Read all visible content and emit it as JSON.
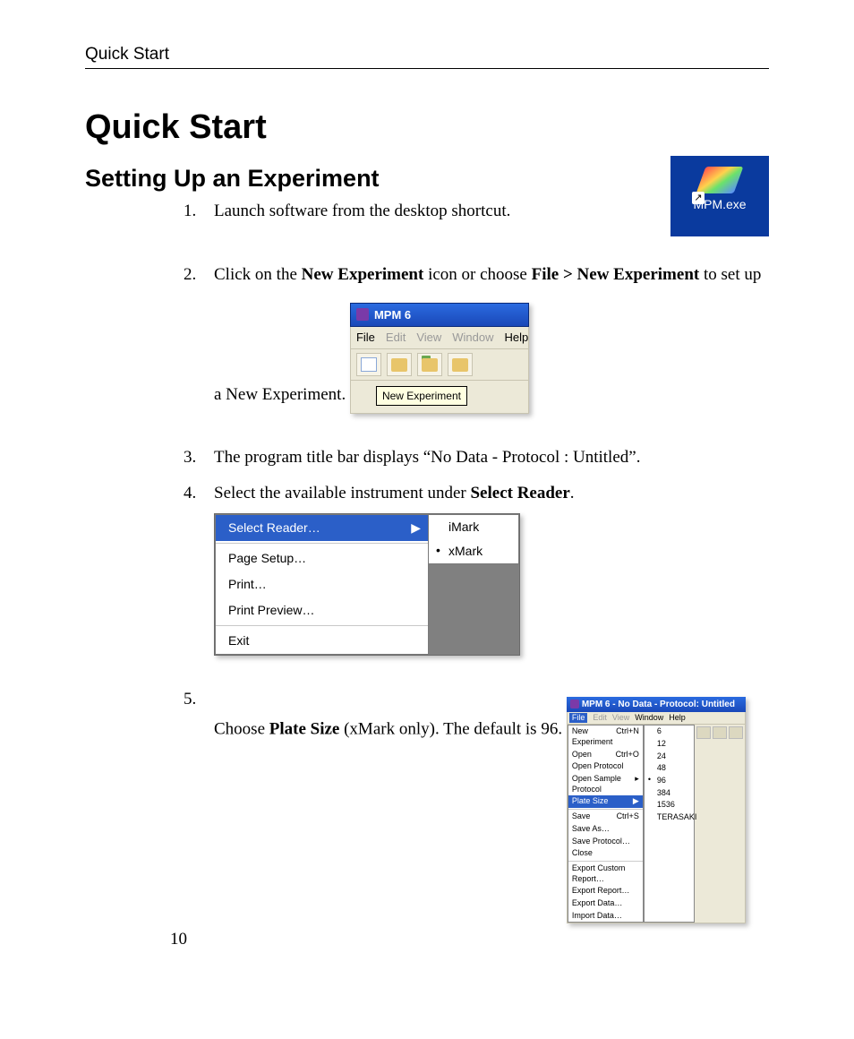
{
  "running_head": "Quick Start",
  "h1": "Quick Start",
  "h2": "Setting Up an Experiment",
  "desktop_icon_label": "MPM.exe",
  "steps": {
    "s1": {
      "num": "1.",
      "text": "Launch software from the desktop shortcut."
    },
    "s2": {
      "num": "2.",
      "pre": "Click on the ",
      "b1": "New Experiment",
      "mid": " icon or choose ",
      "b2": "File > New Experiment",
      "post": " to set up a New Experiment."
    },
    "s3": {
      "num": "3.",
      "text": "The program title bar displays “No Data - Protocol : Untitled”."
    },
    "s4": {
      "num": "4.",
      "pre": "Select the available instrument under ",
      "b1": "Select Reader",
      "post": "."
    },
    "s5": {
      "num": "5.",
      "pre": "Choose ",
      "b1": "Plate Size",
      "post": " (xMark only).  The default is 96."
    }
  },
  "shot1": {
    "title": "MPM 6",
    "menu": {
      "file": "File",
      "edit": "Edit",
      "view": "View",
      "window": "Window",
      "help": "Help"
    },
    "tooltip": "New Experiment"
  },
  "shot2": {
    "select_reader": "Select Reader…",
    "page_setup": "Page Setup…",
    "print": "Print…",
    "print_preview": "Print Preview…",
    "exit": "Exit",
    "opt1": "iMark",
    "opt2": "xMark"
  },
  "shot3": {
    "title": "MPM 6 - No Data - Protocol: Untitled",
    "menu": {
      "file": "File",
      "edit": "Edit",
      "view": "View",
      "window": "Window",
      "help": "Help"
    },
    "file_items": {
      "new_exp": "New Experiment",
      "new_exp_sc": "Ctrl+N",
      "open": "Open",
      "open_sc": "Ctrl+O",
      "open_protocol": "Open Protocol",
      "open_sample": "Open Sample Protocol",
      "plate_size": "Plate Size",
      "save": "Save",
      "save_sc": "Ctrl+S",
      "save_as": "Save As…",
      "save_protocol": "Save Protocol…",
      "close": "Close",
      "export_custom": "Export Custom Report…",
      "export_report": "Export Report…",
      "export_data": "Export Data…",
      "import_data": "Import Data…"
    },
    "sizes": {
      "s6": "6",
      "s12": "12",
      "s24": "24",
      "s48": "48",
      "s96": "96",
      "s384": "384",
      "s1536": "1536",
      "sT": "TERASAKI"
    }
  },
  "page_number": "10"
}
